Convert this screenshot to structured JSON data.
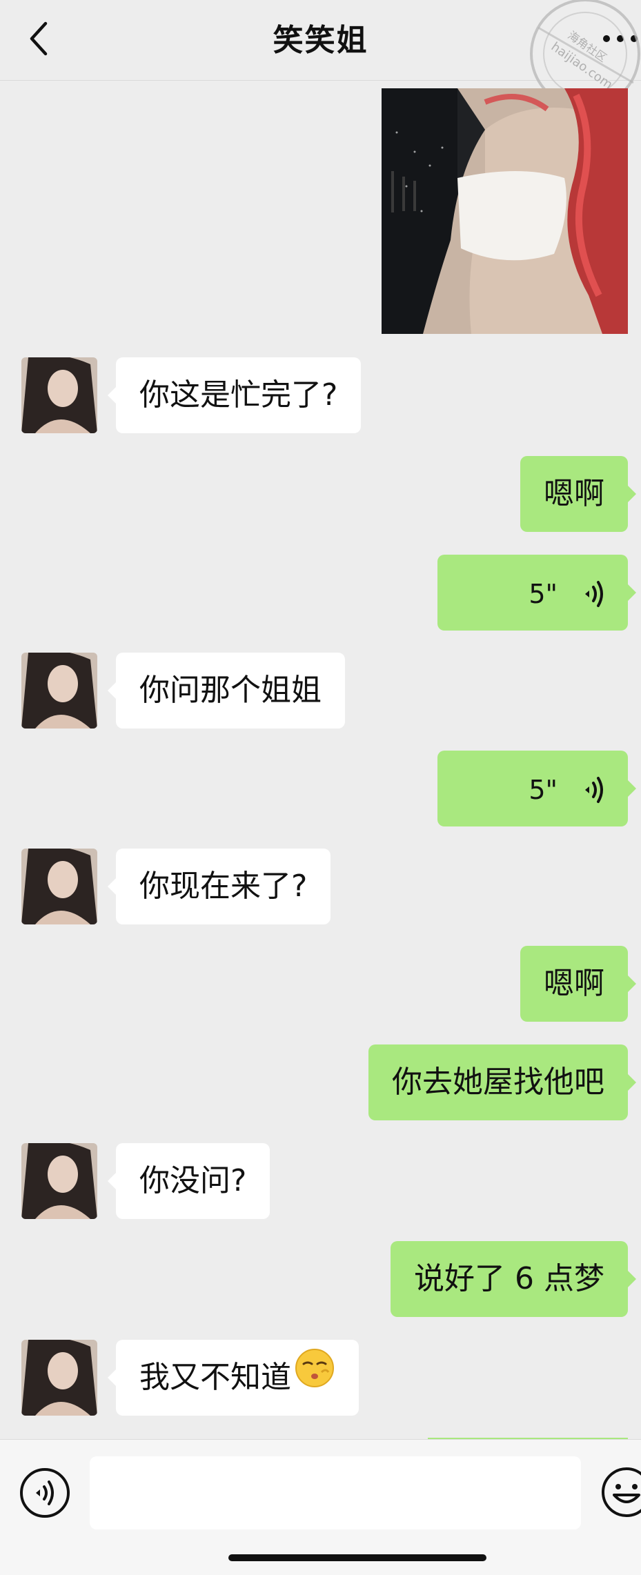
{
  "header": {
    "title": "笑笑姐",
    "back_icon": "chevron-left-icon",
    "more_icon": "more-icon"
  },
  "watermark": {
    "line1": "海角社区",
    "line2": "haijiao.com"
  },
  "messages": [
    {
      "side": "out",
      "type": "image",
      "description": ""
    },
    {
      "side": "in",
      "type": "text",
      "text": "你这是忙完了?"
    },
    {
      "side": "out",
      "type": "text",
      "text": "嗯啊"
    },
    {
      "side": "out",
      "type": "voice",
      "duration": "5\""
    },
    {
      "side": "in",
      "type": "text",
      "text": "你问那个姐姐"
    },
    {
      "side": "out",
      "type": "voice",
      "duration": "5\""
    },
    {
      "side": "in",
      "type": "text",
      "text": "你现在来了?"
    },
    {
      "side": "out",
      "type": "text",
      "text": "嗯啊"
    },
    {
      "side": "out",
      "type": "text",
      "text": "你去她屋找他吧"
    },
    {
      "side": "in",
      "type": "text",
      "text": "你没问?"
    },
    {
      "side": "out",
      "type": "text",
      "text": "说好了 6 点梦"
    },
    {
      "side": "in",
      "type": "text",
      "text": "我又不知道",
      "emoji": "shush-face-emoji"
    }
  ],
  "footer": {
    "input_value": "",
    "voice_icon": "voice-input-icon",
    "emoji_icon": "emoji-icon"
  },
  "colors": {
    "background": "#ededed",
    "incoming_bubble": "#ffffff",
    "outgoing_bubble": "#a9e87f"
  }
}
